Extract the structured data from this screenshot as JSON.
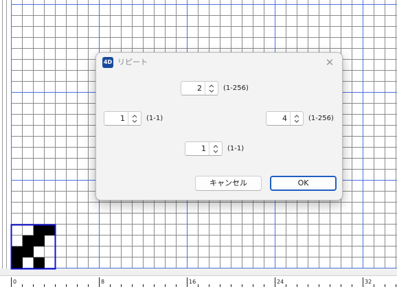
{
  "dialog": {
    "title": "リピート",
    "app_icon_text": "4D",
    "close_glyph": "✕",
    "spinners": {
      "top": {
        "value": "2",
        "range": "(1-256)"
      },
      "left": {
        "value": "1",
        "range": "(1-1)"
      },
      "right": {
        "value": "4",
        "range": "(1-256)"
      },
      "bottom": {
        "value": "1",
        "range": "(1-1)"
      }
    },
    "cancel_label": "キャンセル",
    "ok_label": "OK"
  },
  "ruler": {
    "labels": [
      "0",
      "8",
      "16",
      "24",
      "32"
    ]
  },
  "pattern": {
    "cells_wide": 4,
    "cells_high": 4,
    "filled": [
      [
        0,
        0,
        1,
        1
      ],
      [
        0,
        1,
        1,
        0
      ],
      [
        1,
        1,
        0,
        0
      ],
      [
        1,
        0,
        1,
        0
      ]
    ]
  },
  "colors": {
    "grid_line": "#8a8a8a",
    "major_line": "#4a6ee0",
    "pattern_fill": "#000000",
    "pattern_border": "#1010d0",
    "accent": "#1f5fbf"
  },
  "icons": {
    "app": "4d-app-icon",
    "close": "close-icon",
    "spinner": "chevron-up-down-icon"
  }
}
